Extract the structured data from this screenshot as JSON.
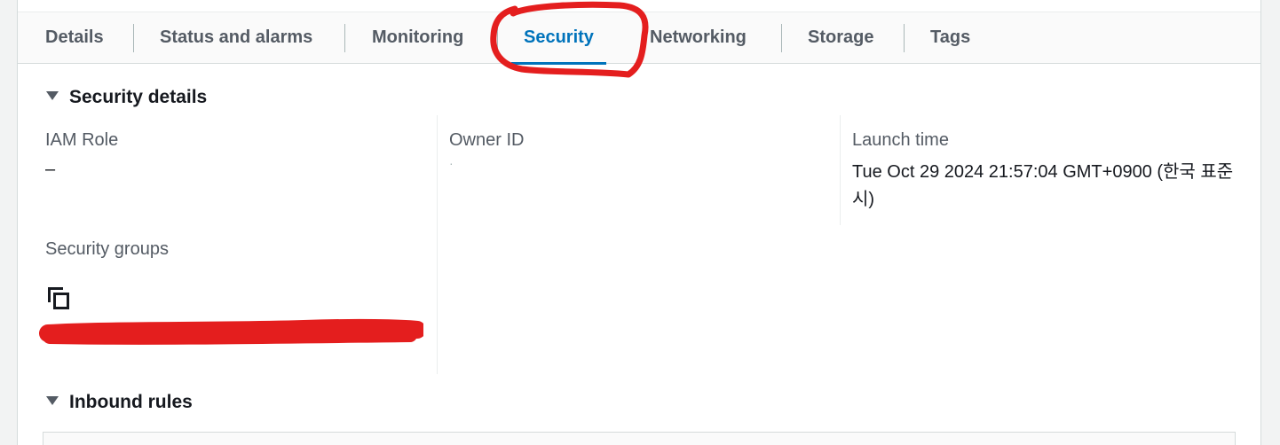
{
  "tabs": [
    {
      "label": "Details",
      "active": false
    },
    {
      "label": "Status and alarms",
      "active": false
    },
    {
      "label": "Monitoring",
      "active": false
    },
    {
      "label": "Security",
      "active": true
    },
    {
      "label": "Networking",
      "active": false
    },
    {
      "label": "Storage",
      "active": false
    },
    {
      "label": "Tags",
      "active": false
    }
  ],
  "security_details": {
    "title": "Security details",
    "iam_role": {
      "label": "IAM Role",
      "value": "–"
    },
    "owner_id": {
      "label": "Owner ID",
      "value": "·"
    },
    "launch_time": {
      "label": "Launch time",
      "value": "Tue Oct 29 2024 21:57:04 GMT+0900 (한국 표준시)"
    },
    "security_groups": {
      "label": "Security groups"
    }
  },
  "inbound_rules": {
    "title": "Inbound rules"
  },
  "colors": {
    "accent": "#0073bb",
    "annotation_red": "#e41e1e",
    "tab_text": "#545b64",
    "label_text": "#545b64"
  },
  "icons": {
    "copy": "copy-icon",
    "expand": "caret-down-icon"
  }
}
